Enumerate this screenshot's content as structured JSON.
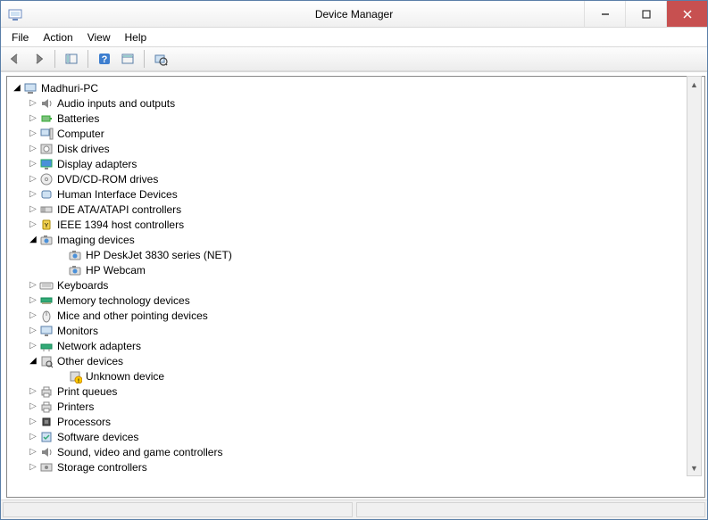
{
  "window": {
    "title": "Device Manager"
  },
  "menus": {
    "file": "File",
    "action": "Action",
    "view": "View",
    "help": "Help"
  },
  "tree": {
    "root": {
      "label": "Madhuri-PC",
      "icon": "computer"
    },
    "nodes": [
      {
        "label": "Audio inputs and outputs",
        "icon": "speaker",
        "expanded": false,
        "children": []
      },
      {
        "label": "Batteries",
        "icon": "battery",
        "expanded": false,
        "children": []
      },
      {
        "label": "Computer",
        "icon": "pc",
        "expanded": false,
        "children": []
      },
      {
        "label": "Disk drives",
        "icon": "disk",
        "expanded": false,
        "children": []
      },
      {
        "label": "Display adapters",
        "icon": "display",
        "expanded": false,
        "children": []
      },
      {
        "label": "DVD/CD-ROM drives",
        "icon": "dvd",
        "expanded": false,
        "children": []
      },
      {
        "label": "Human Interface Devices",
        "icon": "hid",
        "expanded": false,
        "children": []
      },
      {
        "label": "IDE ATA/ATAPI controllers",
        "icon": "ide",
        "expanded": false,
        "children": []
      },
      {
        "label": "IEEE 1394 host controllers",
        "icon": "firewire",
        "expanded": false,
        "children": []
      },
      {
        "label": "Imaging devices",
        "icon": "camera",
        "expanded": true,
        "children": [
          {
            "label": "HP DeskJet 3830 series (NET)",
            "icon": "camera"
          },
          {
            "label": "HP Webcam",
            "icon": "camera"
          }
        ]
      },
      {
        "label": "Keyboards",
        "icon": "keyboard",
        "expanded": false,
        "children": []
      },
      {
        "label": "Memory technology devices",
        "icon": "memory",
        "expanded": false,
        "children": []
      },
      {
        "label": "Mice and other pointing devices",
        "icon": "mouse",
        "expanded": false,
        "children": []
      },
      {
        "label": "Monitors",
        "icon": "monitor",
        "expanded": false,
        "children": []
      },
      {
        "label": "Network adapters",
        "icon": "network",
        "expanded": false,
        "children": []
      },
      {
        "label": "Other devices",
        "icon": "other",
        "expanded": true,
        "children": [
          {
            "label": "Unknown device",
            "icon": "unknown"
          }
        ]
      },
      {
        "label": "Print queues",
        "icon": "printer",
        "expanded": false,
        "children": []
      },
      {
        "label": "Printers",
        "icon": "printer",
        "expanded": false,
        "children": []
      },
      {
        "label": "Processors",
        "icon": "cpu",
        "expanded": false,
        "children": []
      },
      {
        "label": "Software devices",
        "icon": "software",
        "expanded": false,
        "children": []
      },
      {
        "label": "Sound, video and game controllers",
        "icon": "speaker",
        "expanded": false,
        "children": []
      },
      {
        "label": "Storage controllers",
        "icon": "storage",
        "expanded": false,
        "children": []
      }
    ]
  }
}
